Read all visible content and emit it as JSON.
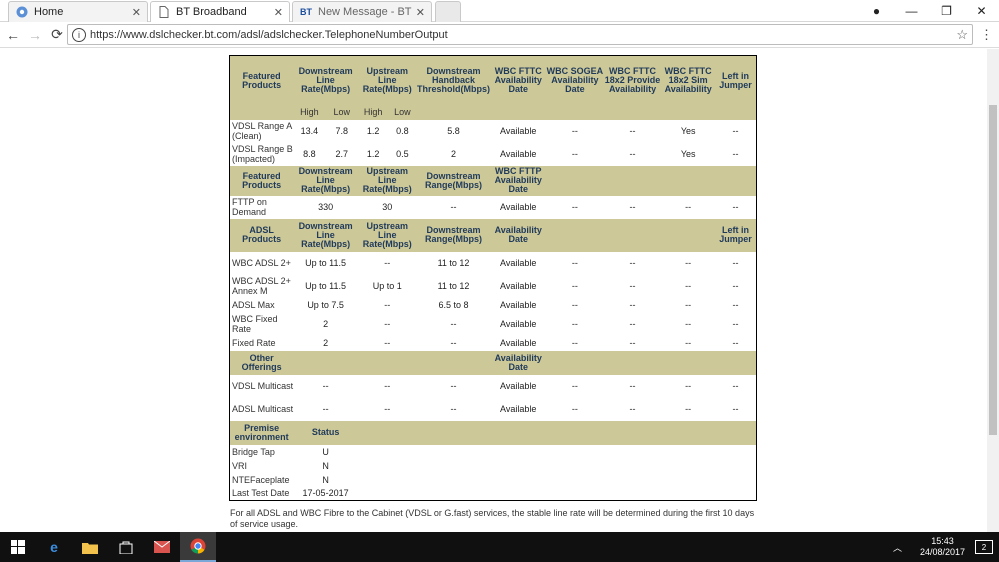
{
  "tabs": [
    {
      "title": "Home",
      "icon": "chrome-icon"
    },
    {
      "title": "BT Broadband",
      "icon": "document-icon"
    },
    {
      "title": "New Message - BTCare C",
      "icon": "bt-icon",
      "icon_text": "BT"
    }
  ],
  "address": {
    "url": "https://www.dslchecker.bt.com/adsl/adslchecker.TelephoneNumberOutput"
  },
  "table": {
    "vdsl_header": [
      "Featured Products",
      "Downstream Line Rate(Mbps)",
      "Upstream Line Rate(Mbps)",
      "Downstream Handback Threshold(Mbps)",
      "WBC FTTC Availability Date",
      "WBC SOGEA Availability Date",
      "WBC FTTC 18x2 Provide Availability",
      "WBC FTTC 18x2 Sim Availability",
      "Left in Jumper"
    ],
    "sub_header": [
      "High",
      "Low",
      "High",
      "Low"
    ],
    "vdsl_rows": [
      {
        "label": "VDSL Range A (Clean)",
        "down_high": "13.4",
        "down_low": "7.8",
        "up_high": "1.2",
        "up_low": "0.8",
        "threshold": "5.8",
        "fttc": "Available",
        "sogea": "--",
        "provide": "--",
        "sim": "Yes",
        "jumper": "--"
      },
      {
        "label": "VDSL Range B (Impacted)",
        "down_high": "8.8",
        "down_low": "2.7",
        "up_high": "1.2",
        "up_low": "0.5",
        "threshold": "2",
        "fttc": "Available",
        "sogea": "--",
        "provide": "--",
        "sim": "Yes",
        "jumper": "--"
      }
    ],
    "fttp_header": [
      "Featured Products",
      "Downstream Line Rate(Mbps)",
      "Upstream Line Rate(Mbps)",
      "Downstream Range(Mbps)",
      "WBC FTTP Availability Date"
    ],
    "fttp_rows": [
      {
        "label": "FTTP on Demand",
        "down": "330",
        "up": "30",
        "range": "--",
        "avail": "Available",
        "c6": "--",
        "c7": "--",
        "c8": "--",
        "c9": "--"
      }
    ],
    "adsl_header": [
      "ADSL Products",
      "Downstream Line Rate(Mbps)",
      "Upstream Line Rate(Mbps)",
      "Downstream Range(Mbps)",
      "Availability Date",
      "Left in Jumper"
    ],
    "adsl_rows": [
      {
        "label": "WBC ADSL 2+",
        "down": "Up to 11.5",
        "up": "--",
        "range": "11 to 12",
        "avail": "Available",
        "c6": "--",
        "c7": "--",
        "c8": "--",
        "c9": "--"
      },
      {
        "label": "WBC ADSL 2+ Annex M",
        "down": "Up to 11.5",
        "up": "Up to 1",
        "range": "11 to 12",
        "avail": "Available",
        "c6": "--",
        "c7": "--",
        "c8": "--",
        "c9": "--"
      },
      {
        "label": "ADSL Max",
        "down": "Up to 7.5",
        "up": "--",
        "range": "6.5 to 8",
        "avail": "Available",
        "c6": "--",
        "c7": "--",
        "c8": "--",
        "c9": "--"
      },
      {
        "label": "WBC Fixed Rate",
        "down": "2",
        "up": "--",
        "range": "--",
        "avail": "Available",
        "c6": "--",
        "c7": "--",
        "c8": "--",
        "c9": "--"
      },
      {
        "label": "Fixed Rate",
        "down": "2",
        "up": "--",
        "range": "--",
        "avail": "Available",
        "c6": "--",
        "c7": "--",
        "c8": "--",
        "c9": "--"
      }
    ],
    "other_header": [
      "Other Offerings",
      "Availability Date"
    ],
    "other_rows": [
      {
        "label": "VDSL Multicast",
        "down": "--",
        "up": "--",
        "range": "--",
        "avail": "Available",
        "c6": "--",
        "c7": "--",
        "c8": "--",
        "c9": "--"
      },
      {
        "label": "ADSL Multicast",
        "down": "--",
        "up": "--",
        "range": "--",
        "avail": "Available",
        "c6": "--",
        "c7": "--",
        "c8": "--",
        "c9": "--"
      }
    ],
    "premise_header": [
      "Premise environment",
      "Status"
    ],
    "premise_rows": [
      {
        "label": "Bridge Tap",
        "status": "U"
      },
      {
        "label": "VRI",
        "status": "N"
      },
      {
        "label": "NTEFaceplate",
        "status": "N"
      },
      {
        "label": "Last Test Date",
        "status": "17-05-2017"
      }
    ]
  },
  "note": "For all ADSL and WBC Fibre to the Cabinet (VDSL or G.fast) services, the stable line rate will be determined during the first 10 days of service usage.",
  "taskbar": {
    "time": "15:43",
    "date": "24/08/2017",
    "notification_count": "2"
  },
  "colors": {
    "header_bg": "#cdc898",
    "header_text": "#1f3a5a"
  }
}
